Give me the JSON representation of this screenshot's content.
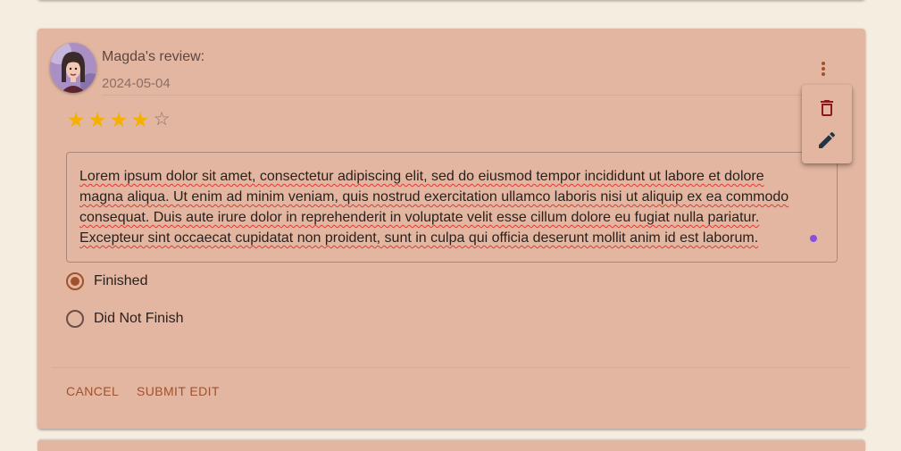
{
  "review": {
    "author_label": "Magda's review:",
    "date": "2024-05-04",
    "rating": 4,
    "max_rating": 5,
    "text": "Lorem ipsum dolor sit amet, consectetur adipiscing elit, sed do eiusmod tempor incididunt ut labore et dolore magna aliqua. Ut enim ad minim veniam, quis nostrud exercitation ullamco laboris nisi ut aliquip ex ea commodo consequat. Duis aute irure dolor in reprehenderit in voluptate velit esse cillum dolore eu fugiat nulla pariatur. Excepteur sint occaecat cupidatat non proident, sunt in culpa qui officia deserunt mollit anim id est laborum."
  },
  "status_options": [
    {
      "label": "Finished",
      "selected": true
    },
    {
      "label": "Did Not Finish",
      "selected": false
    }
  ],
  "actions": {
    "cancel_label": "CANCEL",
    "submit_label": "SUBMIT EDIT"
  },
  "menu": {
    "icons": [
      "more-vert-icon",
      "delete-icon",
      "edit-icon"
    ]
  },
  "colors": {
    "card_bg": "#e2b6a0",
    "page_bg": "#f6ede1",
    "accent": "#a0522d",
    "star": "#f5b000",
    "delete": "#8b1a1a",
    "edit": "#1f3548"
  }
}
